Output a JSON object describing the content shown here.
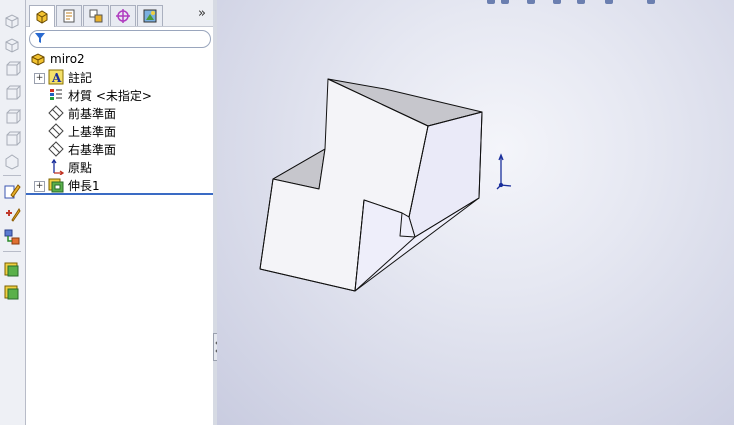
{
  "feature_tree": {
    "root": {
      "label": "miro2",
      "icon": "part-icon"
    },
    "items": [
      {
        "label": "註記",
        "icon": "annotations-icon",
        "expandable": true
      },
      {
        "label": "材質 <未指定>",
        "icon": "material-icon",
        "expandable": false
      },
      {
        "label": "前基準面",
        "icon": "plane-icon",
        "expandable": false
      },
      {
        "label": "上基準面",
        "icon": "plane-icon",
        "expandable": false
      },
      {
        "label": "右基準面",
        "icon": "plane-icon",
        "expandable": false
      },
      {
        "label": "原點",
        "icon": "origin-icon",
        "expandable": false
      },
      {
        "label": "伸長1",
        "icon": "extrude-icon",
        "expandable": true
      }
    ]
  },
  "panel_tabs": [
    {
      "icon": "feature-manager-icon",
      "active": true
    },
    {
      "icon": "property-manager-icon",
      "active": false
    },
    {
      "icon": "configuration-manager-icon",
      "active": false
    },
    {
      "icon": "dimxpert-icon",
      "active": false
    },
    {
      "icon": "display-manager-icon",
      "active": false
    }
  ],
  "colors": {
    "accent": "#3a6bc4",
    "model_face_light": "#f4f4f8",
    "model_face_side": "#eaeaf8",
    "model_face_top": "#c6c6cc",
    "triad_blue": "#1a2f9c"
  }
}
